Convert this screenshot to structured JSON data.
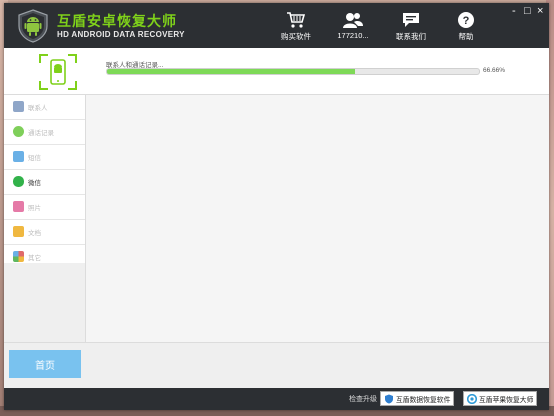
{
  "app": {
    "title": "互盾安卓恢复大师",
    "subtitle": "HD ANDROID DATA RECOVERY",
    "accent": "#7fd11a",
    "window_controls": [
      "-",
      "□",
      "×"
    ]
  },
  "nav": {
    "buy": {
      "label": "购买软件",
      "icon": "cart-icon"
    },
    "user": {
      "label": "177210...",
      "icon": "user-icon"
    },
    "contact": {
      "label": "联系我们",
      "icon": "chat-icon"
    },
    "help": {
      "label": "帮助",
      "icon": "help-icon"
    }
  },
  "scan": {
    "status": "联系人和通话记录...",
    "percent": "66.66%",
    "progress": 0.6666,
    "bar_color": "#7ed957"
  },
  "sidebar": {
    "items": [
      {
        "label": "联系人",
        "icon": "contacts-icon",
        "color": "#8fa6c8",
        "active": false
      },
      {
        "label": "通话记录",
        "icon": "phone-icon",
        "color": "#7fcf5a",
        "active": false
      },
      {
        "label": "短信",
        "icon": "sms-icon",
        "color": "#6ab0e6",
        "active": false
      },
      {
        "label": "微信",
        "icon": "wechat-icon",
        "color": "#32b24a",
        "active": true
      },
      {
        "label": "照片",
        "icon": "photo-icon",
        "color": "#e57aa7",
        "active": false
      },
      {
        "label": "文档",
        "icon": "document-icon",
        "color": "#f0b840",
        "active": false
      },
      {
        "label": "其它",
        "icon": "other-icon",
        "color": "#e06a6a",
        "active": false
      }
    ]
  },
  "home_button": "首页",
  "footer": {
    "update": "检查升级",
    "btn1": "互盾数据恢复软件",
    "btn2": "互盾苹果恢复大师"
  }
}
